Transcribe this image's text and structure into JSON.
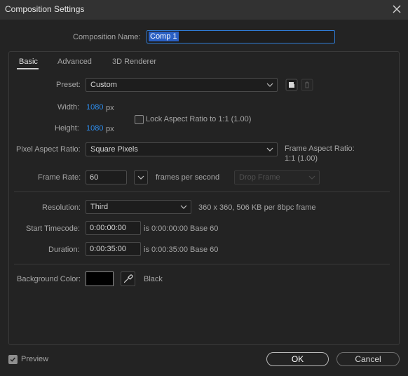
{
  "window": {
    "title": "Composition Settings"
  },
  "comp_name": {
    "label": "Composition Name:",
    "value": "Comp 1"
  },
  "tabs": [
    {
      "label": "Basic",
      "active": true
    },
    {
      "label": "Advanced",
      "active": false
    },
    {
      "label": "3D Renderer",
      "active": false
    }
  ],
  "preset": {
    "label": "Preset:",
    "value": "Custom"
  },
  "width": {
    "label": "Width:",
    "value": "1080",
    "unit": "px"
  },
  "height": {
    "label": "Height:",
    "value": "1080",
    "unit": "px"
  },
  "lock_aspect": {
    "label": "Lock Aspect Ratio to 1:1 (1.00)",
    "checked": false
  },
  "pixel_aspect": {
    "label": "Pixel Aspect Ratio:",
    "value": "Square Pixels"
  },
  "frame_aspect": {
    "label": "Frame Aspect Ratio:",
    "value": "1:1 (1.00)"
  },
  "frame_rate": {
    "label": "Frame Rate:",
    "value": "60",
    "unit": "frames per second",
    "drop_frame": "Drop Frame"
  },
  "resolution": {
    "label": "Resolution:",
    "value": "Third",
    "info": "360 x 360, 506 KB per 8bpc frame"
  },
  "start_timecode": {
    "label": "Start Timecode:",
    "value": "0:00:00:00",
    "info": "is 0:00:00:00  Base 60"
  },
  "duration": {
    "label": "Duration:",
    "value": "0:00:35:00",
    "info": "is 0:00:35:00  Base 60"
  },
  "background": {
    "label": "Background Color:",
    "color": "#000000",
    "name": "Black"
  },
  "preview": {
    "label": "Preview",
    "checked": true
  },
  "buttons": {
    "ok": "OK",
    "cancel": "Cancel"
  },
  "colors": {
    "accent": "#2d8ceb",
    "background": "#232323",
    "titlebar": "#323232"
  }
}
